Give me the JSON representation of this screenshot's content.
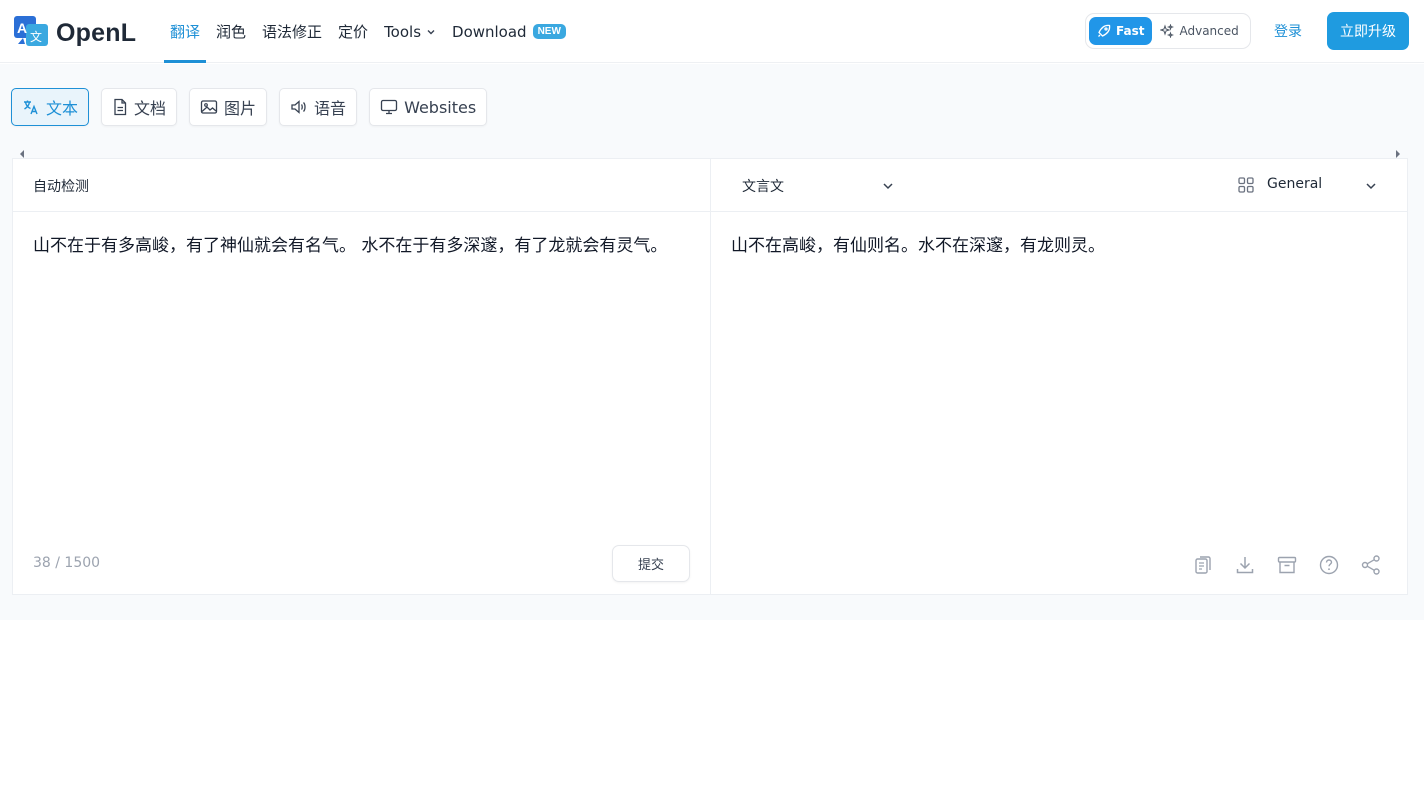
{
  "header": {
    "brand": "OpenL",
    "nav": [
      {
        "label": "翻译",
        "active": true
      },
      {
        "label": "润色",
        "active": false
      },
      {
        "label": "语法修正",
        "active": false
      },
      {
        "label": "定价",
        "active": false
      },
      {
        "label": "Tools",
        "active": false
      },
      {
        "label": "Download",
        "active": false
      }
    ],
    "download_badge": "NEW",
    "modes": [
      {
        "label": "Fast",
        "active": true,
        "icon": "rocket-icon"
      },
      {
        "label": "Advanced",
        "active": false,
        "icon": "sparkles-icon"
      }
    ],
    "login": "登录",
    "upgrade": "立即升级"
  },
  "tabs": [
    {
      "label": "文本",
      "icon": "translate-icon",
      "active": true
    },
    {
      "label": "文档",
      "icon": "document-icon",
      "active": false
    },
    {
      "label": "图片",
      "icon": "image-icon",
      "active": false
    },
    {
      "label": "语音",
      "icon": "speaker-icon",
      "active": false
    },
    {
      "label": "Websites",
      "icon": "monitor-icon",
      "active": false
    }
  ],
  "source": {
    "language": "自动检测",
    "text": "山不在于有多高峻，有了神仙就会有名气。 水不在于有多深邃，有了龙就会有灵气。",
    "counter": "38 / 1500",
    "submit": "提交"
  },
  "target": {
    "language": "文言文",
    "domain": "General",
    "text": "山不在高峻，有仙则名。水不在深邃，有龙则灵。",
    "actions": [
      "copy-icon",
      "download-icon",
      "archive-icon",
      "help-icon",
      "share-icon"
    ]
  },
  "colors": {
    "accent": "#1e90d6",
    "upgrade_bg": "#1f9be0",
    "badge_bg": "#3aa8e0"
  }
}
